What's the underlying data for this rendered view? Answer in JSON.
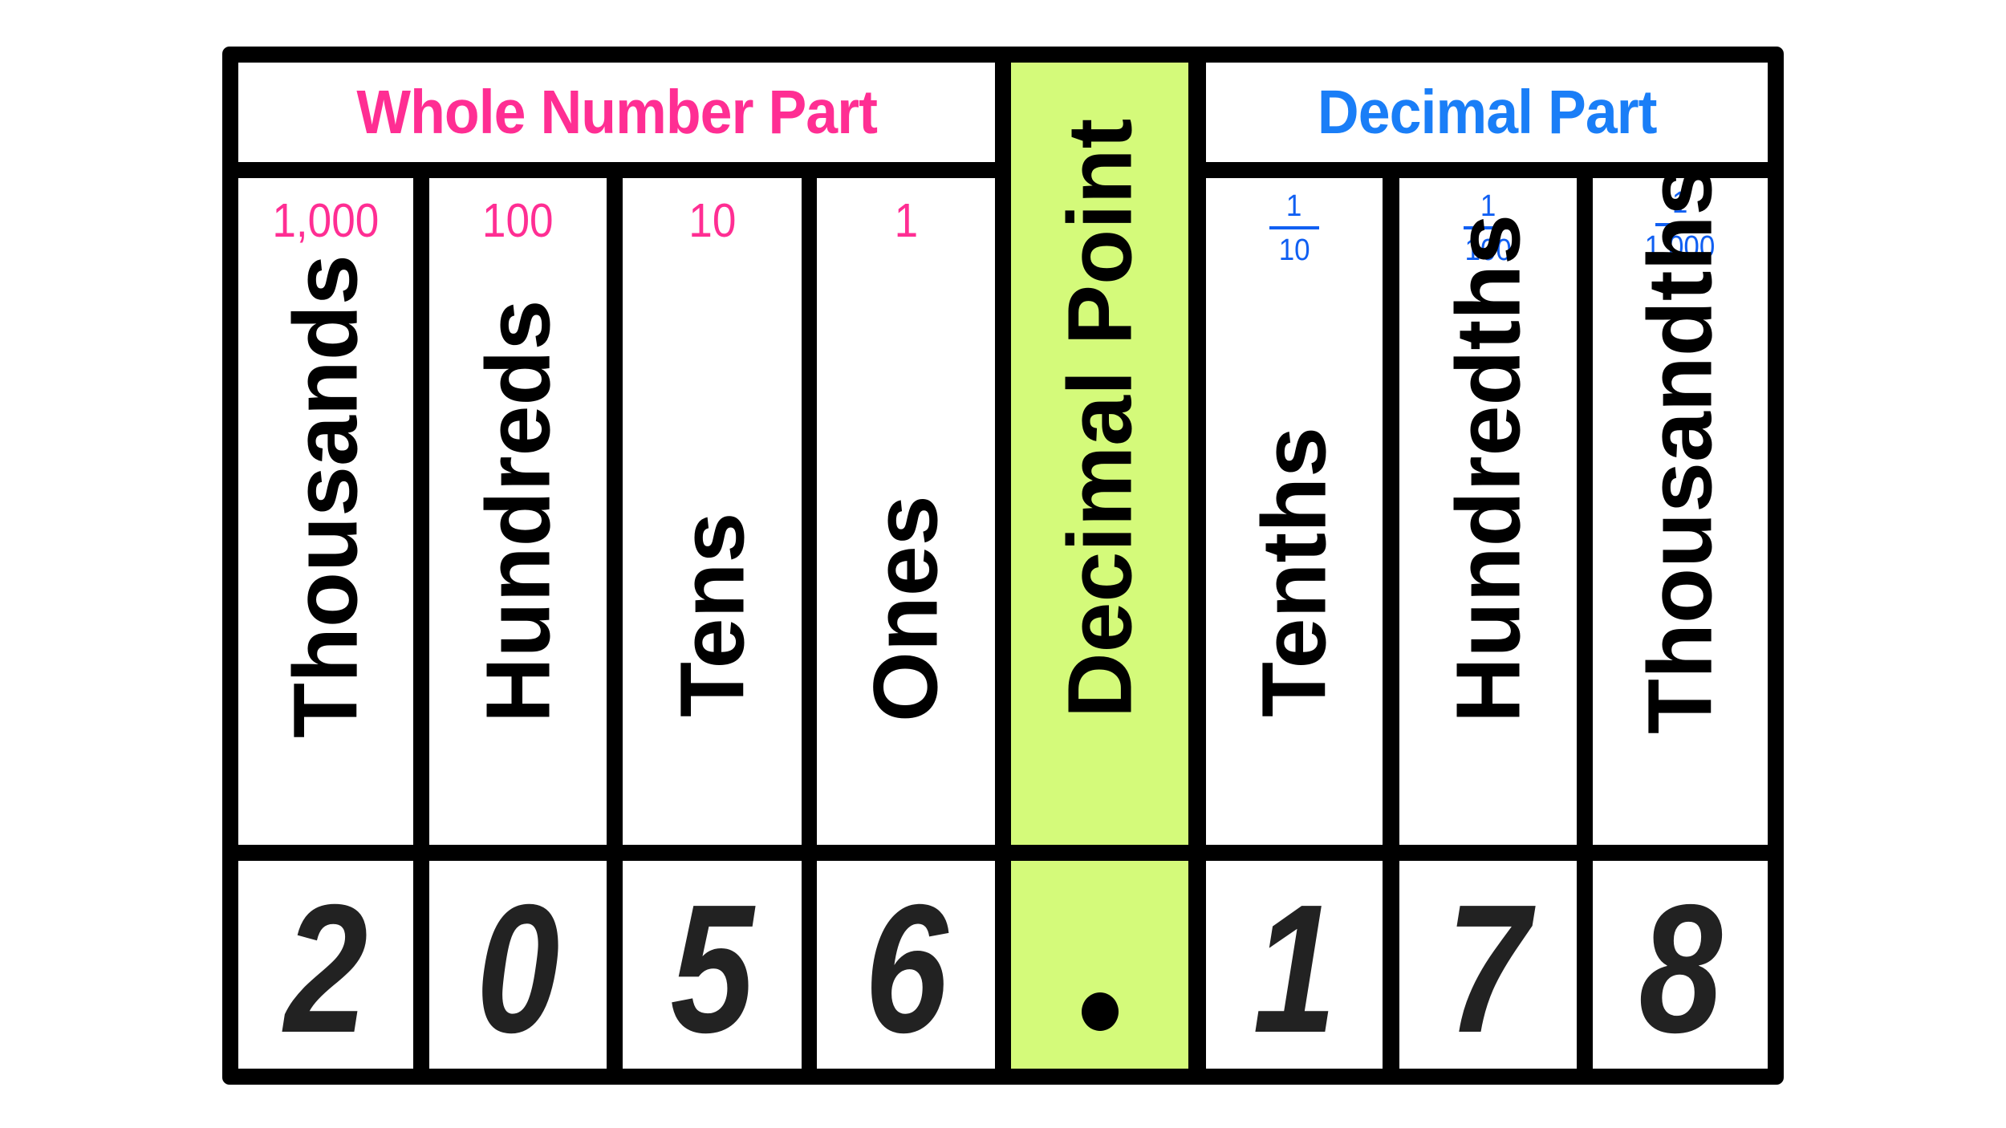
{
  "header": {
    "whole_number_part": "Whole Number Part",
    "decimal_part": "Decimal Part"
  },
  "colors": {
    "whole_part_accent": "#ff2e93",
    "decimal_part_accent": "#1a7ef7",
    "decimal_point_highlight": "#d4fa7a",
    "border": "#000000"
  },
  "columns": [
    {
      "place": "Thousands",
      "value": "1,000",
      "digit": "2"
    },
    {
      "place": "Hundreds",
      "value": "100",
      "digit": "0"
    },
    {
      "place": "Tens",
      "value": "10",
      "digit": "5"
    },
    {
      "place": "Ones",
      "value": "1",
      "digit": "6"
    },
    {
      "place": "Decimal Point",
      "digit": "."
    },
    {
      "place": "Tenths",
      "value": {
        "numerator": "1",
        "denominator": "10"
      },
      "digit": "1"
    },
    {
      "place": "Hundredths",
      "value": {
        "numerator": "1",
        "denominator": "100"
      },
      "digit": "7"
    },
    {
      "place": "Thousandths",
      "value": {
        "numerator": "1",
        "denominator": "1,000"
      },
      "digit": "8"
    }
  ],
  "number": "2056.178"
}
